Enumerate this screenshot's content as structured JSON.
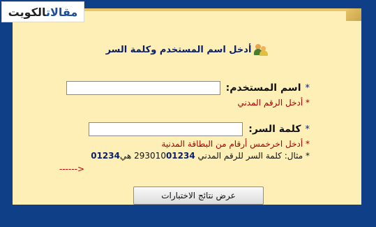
{
  "watermark": {
    "part1": "مقالات",
    "part2": "الكويت"
  },
  "header": {
    "title": "أدخل اسم المستخدم وكلمة السر"
  },
  "form": {
    "star": "*",
    "username": {
      "label": "اسم المستخدم:",
      "value": "",
      "hint": "أدخل الرقم المدني"
    },
    "password": {
      "label": "كلمة السر:",
      "value": "",
      "hint": "أدخل اخرخمس أرقام من البطاقة المدنية"
    },
    "example": {
      "prefix": "مثال: كلمة السر للرقم المدني",
      "civil_tail_bold": "01234",
      "civil_head": "293010",
      "connector": "هي",
      "password_bold": "01234"
    },
    "arrow": "------>",
    "submit_label": "عرض نتائج الاختبارات"
  },
  "colors": {
    "background": "#0e3f87",
    "panel": "#fdefb6",
    "hint": "#a80000",
    "title": "#0b1e66"
  }
}
